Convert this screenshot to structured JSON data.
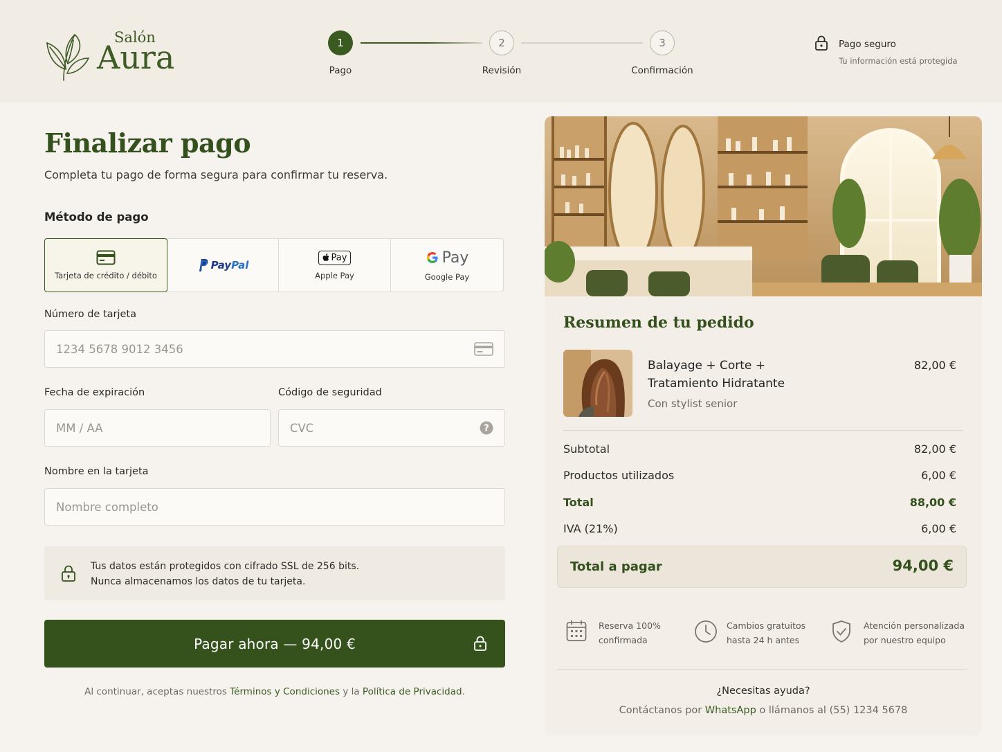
{
  "brand": {
    "small": "Salón",
    "big": "Aura"
  },
  "steps": [
    {
      "num": "1",
      "label": "Pago",
      "state": "active"
    },
    {
      "num": "2",
      "label": "Revisión",
      "state": "idle"
    },
    {
      "num": "3",
      "label": "Confirmación",
      "state": "idle"
    }
  ],
  "secure": {
    "title": "Pago seguro",
    "subtitle": "Tu información está protegida",
    "icon": "lock-icon"
  },
  "page": {
    "title": "Finalizar pago",
    "subtitle": "Completa tu pago de forma segura para confirmar tu reserva."
  },
  "payment": {
    "section_label": "Método de pago",
    "methods": [
      {
        "label": "Tarjeta de crédito / débito",
        "icon": "credit-card-icon",
        "selected": true
      },
      {
        "label": "PayPal",
        "icon": "paypal-logo",
        "selected": false
      },
      {
        "label": "Apple Pay",
        "icon": "apple-pay-logo",
        "badge": "Pay",
        "selected": false
      },
      {
        "label": "Google Pay",
        "icon": "google-pay-logo",
        "badge": "Pay",
        "selected": false
      }
    ]
  },
  "form": {
    "card_number": {
      "label": "Número de tarjeta",
      "placeholder": "1234 5678 9012 3456"
    },
    "expiry": {
      "label": "Fecha de expiración",
      "placeholder": "MM / AA"
    },
    "cvc": {
      "label": "Código de seguridad",
      "placeholder": "CVC"
    },
    "name": {
      "label": "Nombre en la tarjeta",
      "placeholder": "Nombre completo"
    }
  },
  "notice": {
    "line1": "Tus datos están protegidos con cifrado SSL de 256 bits.",
    "line2": "Nunca almacenamos los datos de tu tarjeta."
  },
  "pay_button": {
    "label": "Pagar ahora — 94,00 €"
  },
  "terms": {
    "prefix": "Al continuar, aceptas nuestros ",
    "terms_link": "Términos y Condiciones",
    "middle": " y la ",
    "privacy_link": "Política de Privacidad",
    "suffix": "."
  },
  "summary": {
    "title": "Resumen de tu pedido",
    "item": {
      "name": "Balayage + Corte + Tratamiento Hidratante",
      "sub": "Con stylist senior",
      "price": "82,00 €"
    },
    "rows": [
      {
        "label": "Subtotal",
        "value": "82,00 €",
        "bold": false
      },
      {
        "label": "Productos utilizados",
        "value": "6,00 €",
        "bold": false
      },
      {
        "label": "Total",
        "value": "88,00 €",
        "bold": true
      },
      {
        "label": "IVA (21%)",
        "value": "6,00 €",
        "bold": false
      }
    ],
    "total": {
      "label": "Total a pagar",
      "value": "94,00 €"
    },
    "features": [
      {
        "icon": "calendar-icon",
        "line1": "Reserva 100%",
        "line2": "confirmada"
      },
      {
        "icon": "clock-icon",
        "line1": "Cambios gratuitos",
        "line2": "hasta 24 h antes"
      },
      {
        "icon": "shield-check-icon",
        "line1": "Atención personalizada",
        "line2": "por nuestro equipo"
      }
    ],
    "help": {
      "title": "¿Necesitas ayuda?",
      "prefix": "Contáctanos por ",
      "whatsapp": "WhatsApp",
      "suffix": " o llámanos al (55) 1234 5678"
    }
  },
  "colors": {
    "accent": "#35521c",
    "background": "#f6f3ee",
    "card": "#f3efe8"
  }
}
